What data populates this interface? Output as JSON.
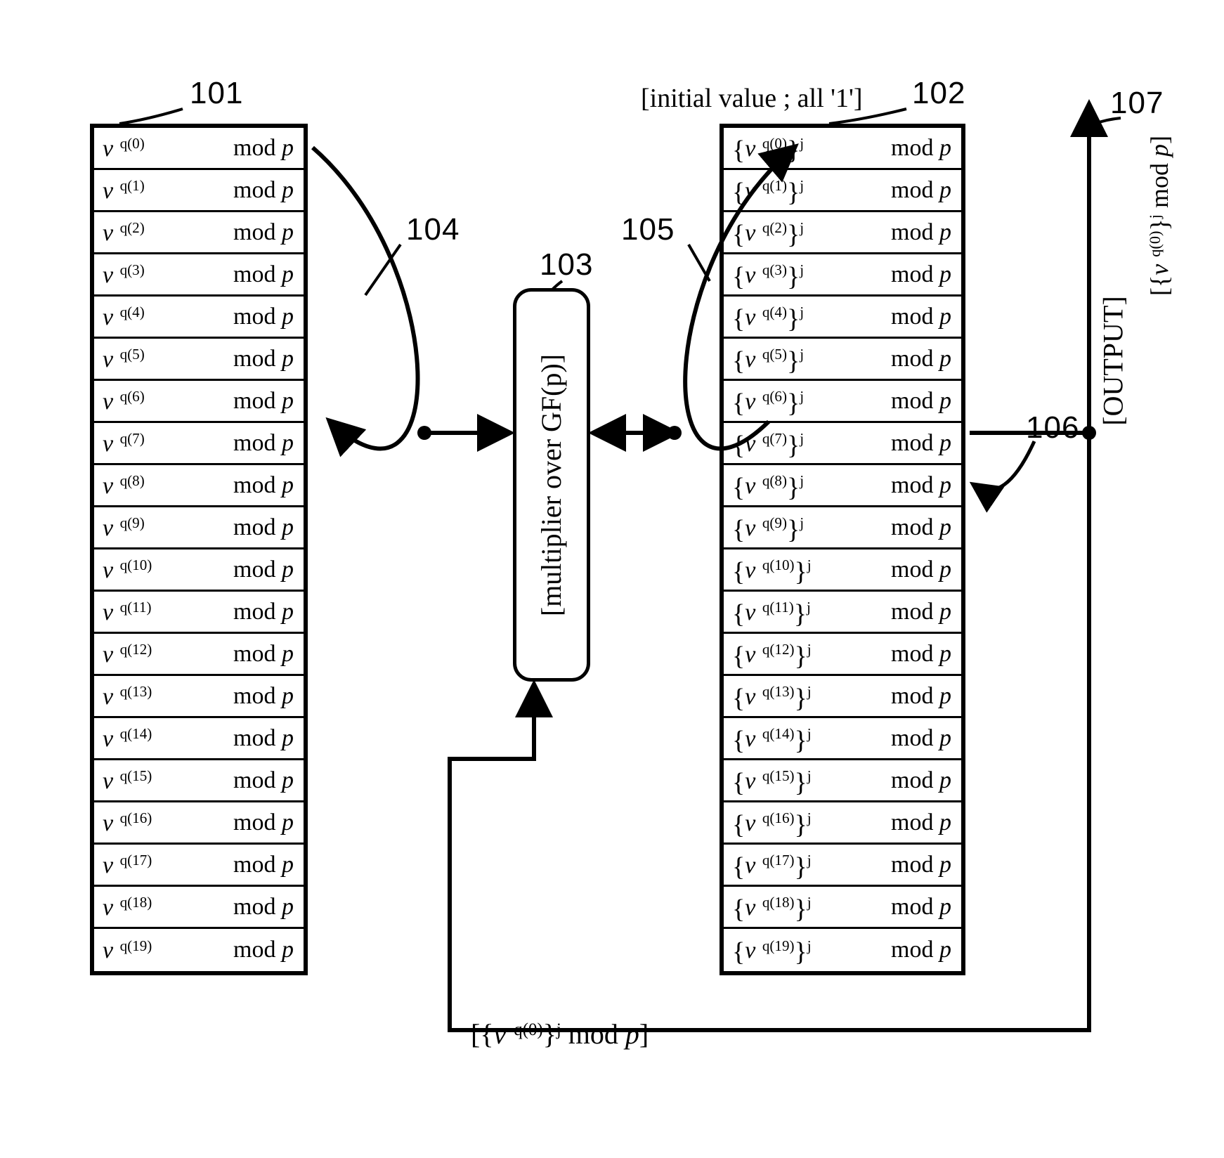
{
  "refs": {
    "r101": "101",
    "r102": "102",
    "r103": "103",
    "r104": "104",
    "r105": "105",
    "r106": "106",
    "r107": "107"
  },
  "notes": {
    "initial_value": "[initial value ; all '1']",
    "feedback": "[{ν q(0)}j mod p]",
    "output": "[OUTPUT]",
    "output_expr": "[{ν q(0)}j mod p]",
    "multiplier": "[multiplier over GF(p)]"
  },
  "table_size": 20,
  "mod_text": "mod p",
  "nu": "ν"
}
